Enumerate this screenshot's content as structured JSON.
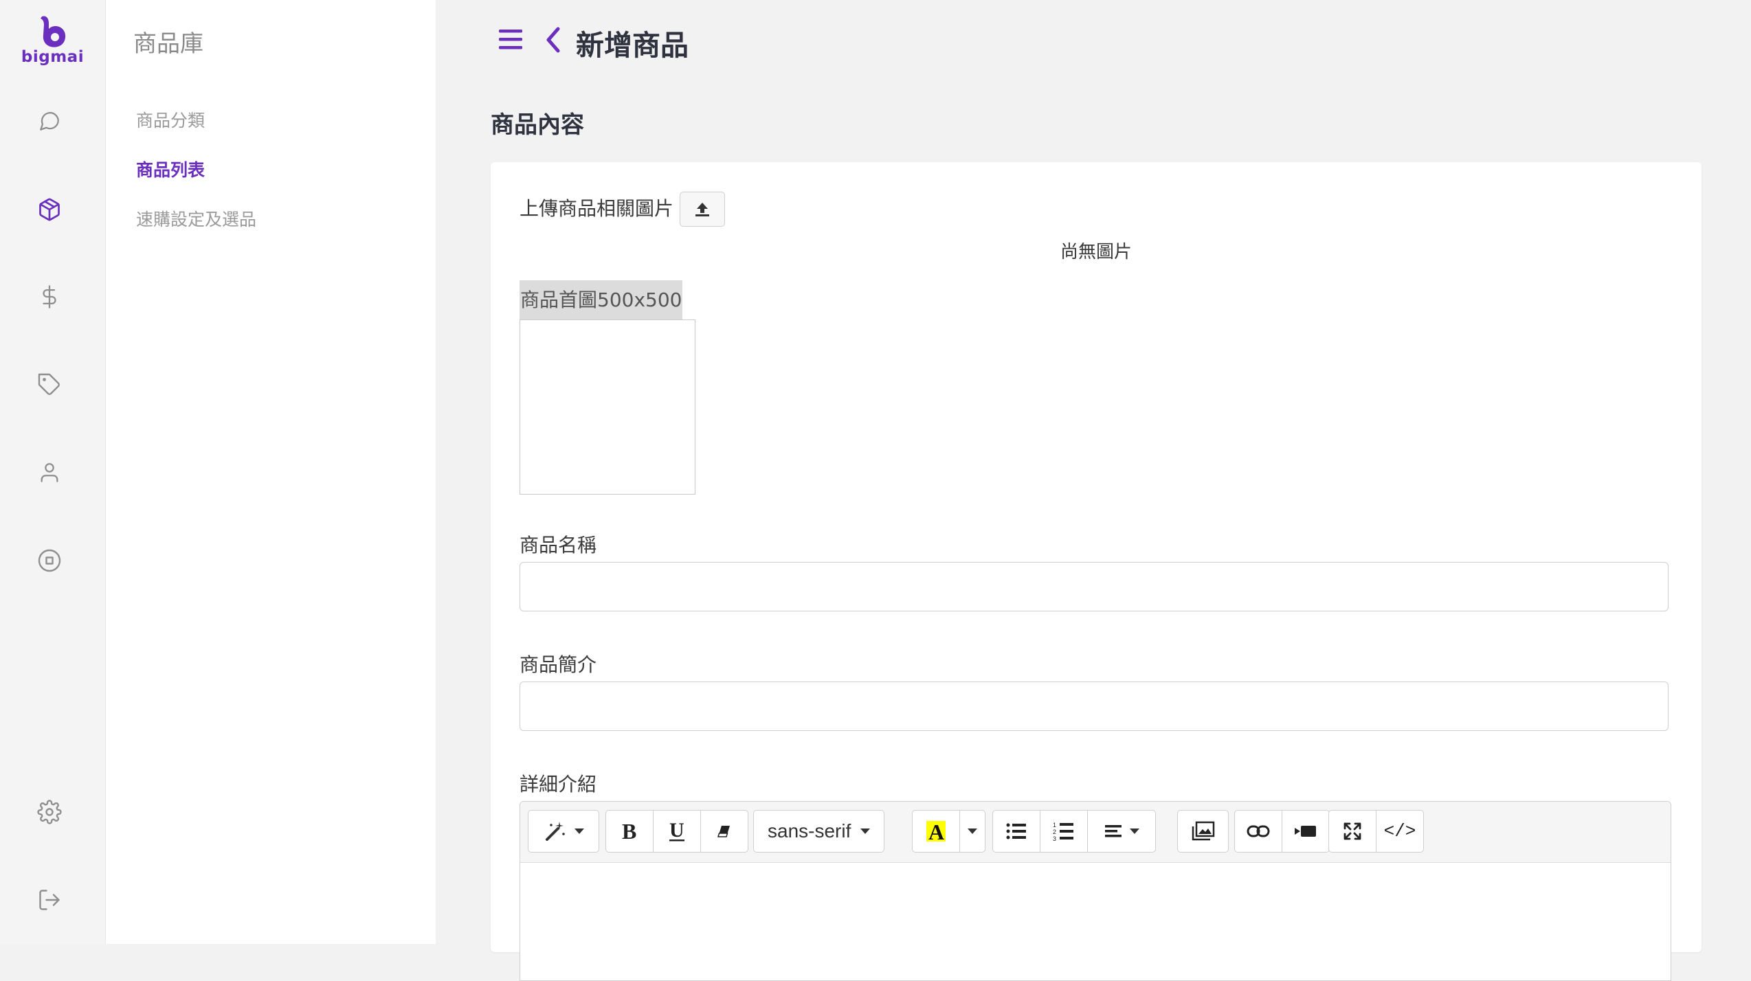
{
  "brand": {
    "name": "bigmai",
    "color": "#6a2fbe"
  },
  "rail": {
    "items": [
      {
        "icon": "chat-bubble-icon",
        "active": false
      },
      {
        "icon": "package-box-icon",
        "active": true
      },
      {
        "icon": "dollar-icon",
        "active": false
      },
      {
        "icon": "tag-icon",
        "active": false
      },
      {
        "icon": "user-icon",
        "active": false
      },
      {
        "icon": "stop-circle-icon",
        "active": false
      }
    ],
    "bottom": [
      {
        "icon": "gear-icon"
      },
      {
        "icon": "logout-icon"
      }
    ]
  },
  "subnav": {
    "title": "商品庫",
    "items": [
      {
        "label": "商品分類",
        "active": false
      },
      {
        "label": "商品列表",
        "active": true
      },
      {
        "label": "速購設定及選品",
        "active": false
      }
    ]
  },
  "header": {
    "title": "新增商品"
  },
  "section": {
    "title": "商品內容"
  },
  "form": {
    "upload_label": "上傳商品相關圖片",
    "no_image_text": "尚無圖片",
    "cover_label": "商品首圖500x500",
    "name": {
      "label": "商品名稱",
      "value": ""
    },
    "summary": {
      "label": "商品簡介",
      "value": ""
    },
    "detail": {
      "label": "詳細介紹"
    }
  },
  "editor": {
    "font_name": "sans-serif",
    "highlight_color": "#ffff00",
    "toolbar_icons": [
      "magic-wand-icon",
      "bold-icon",
      "underline-icon",
      "eraser-icon",
      "font-family-dropdown",
      "text-color-icon",
      "color-dropdown-icon",
      "bullet-list-icon",
      "ordered-list-icon",
      "align-icon",
      "picture-icon",
      "link-icon",
      "video-icon",
      "fullscreen-icon",
      "code-view-icon"
    ],
    "code_label": "</>"
  }
}
